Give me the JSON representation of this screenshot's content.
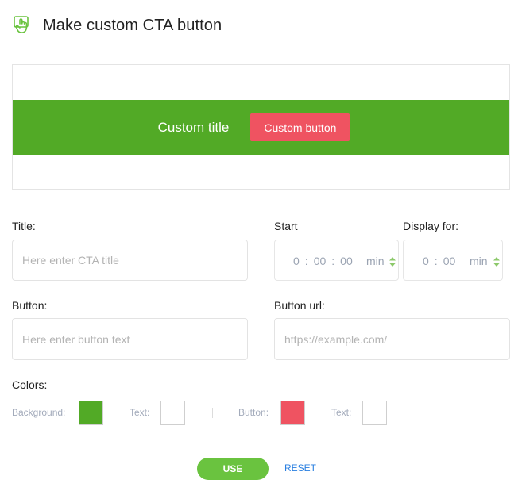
{
  "header": {
    "title": "Make custom CTA button",
    "icon": "hand-pointer-icon"
  },
  "preview": {
    "title": "Custom title",
    "button_label": "Custom button",
    "background_color": "#52aa26",
    "button_color": "#ef5361",
    "text_color": "#ffffff"
  },
  "form": {
    "title_label": "Title:",
    "title_placeholder": "Here enter CTA title",
    "title_value": "",
    "start_label": "Start",
    "start_hours": "0",
    "start_minutes": "00",
    "start_seconds": "00",
    "start_unit": "min",
    "display_label": "Display for:",
    "display_hours": "0",
    "display_minutes": "00",
    "display_unit": "min",
    "button_label": "Button:",
    "button_placeholder": "Here enter button text",
    "button_value": "",
    "url_label": "Button url:",
    "url_placeholder": "https://example.com/",
    "url_value": ""
  },
  "colors": {
    "label": "Colors:",
    "background_label": "Background:",
    "background_color": "#52aa26",
    "text_label": "Text:",
    "text_color": "#ffffff",
    "button_label": "Button:",
    "button_color": "#ef5361",
    "button_text_label": "Text:",
    "button_text_color": "#ffffff"
  },
  "actions": {
    "use_label": "USE",
    "use_color": "#6ac33f",
    "reset_label": "RESET",
    "reset_color": "#2a7fe0"
  },
  "accent": {
    "spinner_color": "#8cc96a",
    "icon_color": "#6ac33f"
  }
}
